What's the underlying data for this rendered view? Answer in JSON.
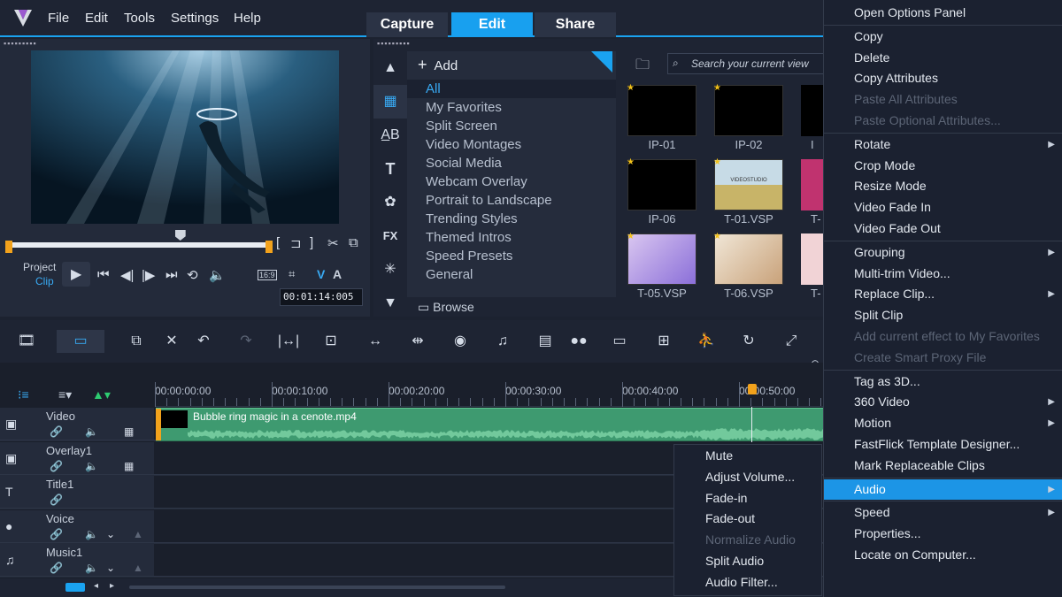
{
  "menubar": {
    "items": [
      "File",
      "Edit",
      "Tools",
      "Settings",
      "Help"
    ]
  },
  "modes": {
    "capture": "Capture",
    "edit": "Edit",
    "share": "Share"
  },
  "player": {
    "project_label": "Project",
    "clip_label": "Clip",
    "aspect": "16:9",
    "timecode": "00:01:14:005",
    "playhead_fraction": 0.65
  },
  "library": {
    "add_label": "Add",
    "categories": [
      "All",
      "My Favorites",
      "Split Screen",
      "Video Montages",
      "Social Media",
      "Webcam Overlay",
      "Portrait to Landscape",
      "Trending Styles",
      "Themed Intros",
      "Speed Presets",
      "General"
    ],
    "browse_label": "Browse",
    "search_placeholder": "Search your current view",
    "thumbs": [
      {
        "label": "IP-01"
      },
      {
        "label": "IP-02"
      },
      {
        "label": "IP-06"
      },
      {
        "label": "T-01.VSP",
        "caption": "VIDEOSTUDIO"
      },
      {
        "label": "T-05.VSP"
      },
      {
        "label": "T-06.VSP"
      }
    ],
    "partial_labels": [
      "I",
      "T-",
      "T-"
    ]
  },
  "ruler": {
    "ticks": [
      "00:00:00:00",
      "00:00:10:00",
      "00:00:20:00",
      "00:00:30:00",
      "00:00:40:00",
      "00:00:50:00"
    ]
  },
  "tracks": [
    {
      "name": "Video"
    },
    {
      "name": "Overlay1"
    },
    {
      "name": "Title1"
    },
    {
      "name": "Voice"
    },
    {
      "name": "Music1"
    }
  ],
  "clip": {
    "name": "Bubble ring magic in a cenote.mp4"
  },
  "context_menu": {
    "items": [
      {
        "label": "Open Options Panel",
        "disabled": false
      },
      {
        "sep": true
      },
      {
        "label": "Copy"
      },
      {
        "label": "Delete"
      },
      {
        "label": "Copy Attributes"
      },
      {
        "label": "Paste All Attributes",
        "disabled": true
      },
      {
        "label": "Paste Optional Attributes...",
        "disabled": true
      },
      {
        "sep": true
      },
      {
        "label": "Rotate",
        "sub": true
      },
      {
        "label": "Crop Mode"
      },
      {
        "label": "Resize Mode"
      },
      {
        "label": "Video Fade In"
      },
      {
        "label": "Video Fade Out"
      },
      {
        "sep": true
      },
      {
        "label": "Grouping",
        "sub": true
      },
      {
        "label": "Multi-trim Video..."
      },
      {
        "label": "Replace Clip...",
        "sub": true
      },
      {
        "label": "Split Clip"
      },
      {
        "label": "Add current effect to My Favorites",
        "disabled": true
      },
      {
        "label": "Create Smart Proxy File",
        "disabled": true
      },
      {
        "sep": true
      },
      {
        "label": "Tag as 3D..."
      },
      {
        "label": "360 Video",
        "sub": true
      },
      {
        "label": "Motion",
        "sub": true
      },
      {
        "label": "FastFlick Template Designer..."
      },
      {
        "label": "Mark Replaceable Clips"
      },
      {
        "sep": true
      },
      {
        "label": "Audio",
        "sub": true,
        "highlight": true
      },
      {
        "sep": true
      },
      {
        "label": "Speed",
        "sub": true
      },
      {
        "label": "Properties..."
      },
      {
        "label": "Locate on Computer..."
      }
    ]
  },
  "audio_submenu": {
    "items": [
      {
        "label": "Mute"
      },
      {
        "label": "Adjust Volume..."
      },
      {
        "label": "Fade-in"
      },
      {
        "label": "Fade-out"
      },
      {
        "label": "Normalize Audio",
        "disabled": true
      },
      {
        "label": "Split Audio"
      },
      {
        "label": "Audio Filter..."
      }
    ]
  },
  "colors": {
    "accent": "#1aa3f0",
    "clip_green": "#3e9a70",
    "highlight": "#1c95e6"
  }
}
